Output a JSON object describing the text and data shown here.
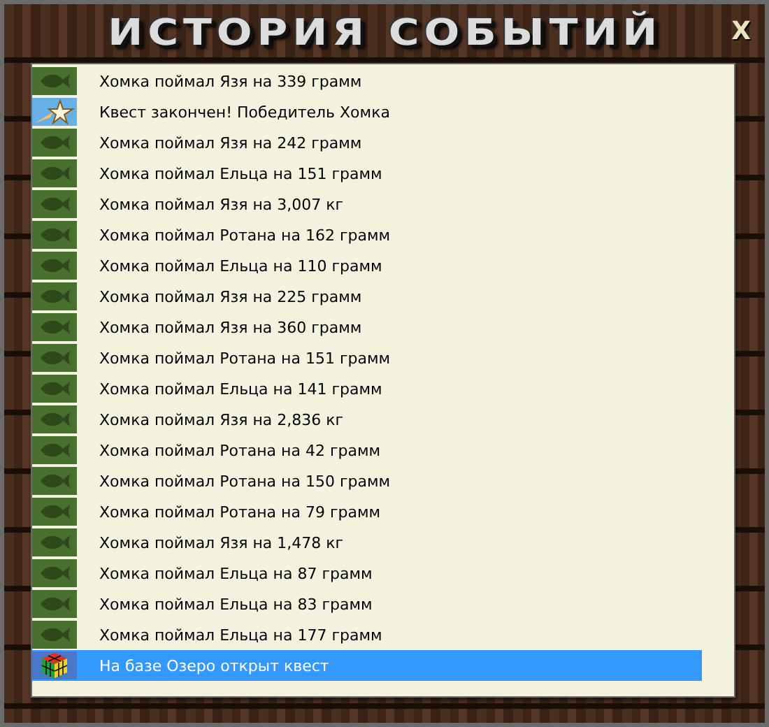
{
  "window": {
    "title": "ИСТОРИЯ СОБЫТИЙ",
    "close": "X"
  },
  "events": [
    {
      "kind": "fish",
      "text": "Хомка поймал Язя на 339 грамм",
      "selected": false
    },
    {
      "kind": "star",
      "text": "Квест закончен! Победитель Хомка",
      "selected": false
    },
    {
      "kind": "fish",
      "text": "Хомка поймал Язя на 242 грамм",
      "selected": false
    },
    {
      "kind": "fish",
      "text": "Хомка поймал Ельца на 151 грамм",
      "selected": false
    },
    {
      "kind": "fish",
      "text": "Хомка поймал Язя на 3,007 кг",
      "selected": false
    },
    {
      "kind": "fish",
      "text": "Хомка поймал Ротана на 162 грамм",
      "selected": false
    },
    {
      "kind": "fish",
      "text": "Хомка поймал Ельца на 110 грамм",
      "selected": false
    },
    {
      "kind": "fish",
      "text": "Хомка поймал Язя на 225 грамм",
      "selected": false
    },
    {
      "kind": "fish",
      "text": "Хомка поймал Язя на 360 грамм",
      "selected": false
    },
    {
      "kind": "fish",
      "text": "Хомка поймал Ротана на 151 грамм",
      "selected": false
    },
    {
      "kind": "fish",
      "text": "Хомка поймал Ельца на 141 грамм",
      "selected": false
    },
    {
      "kind": "fish",
      "text": "Хомка поймал Язя на 2,836 кг",
      "selected": false
    },
    {
      "kind": "fish",
      "text": "Хомка поймал Ротана на 42 грамм",
      "selected": false
    },
    {
      "kind": "fish",
      "text": "Хомка поймал Ротана на 150 грамм",
      "selected": false
    },
    {
      "kind": "fish",
      "text": "Хомка поймал Ротана на 79 грамм",
      "selected": false
    },
    {
      "kind": "fish",
      "text": "Хомка поймал Язя на 1,478 кг",
      "selected": false
    },
    {
      "kind": "fish",
      "text": "Хомка поймал Ельца на 87 грамм",
      "selected": false
    },
    {
      "kind": "fish",
      "text": "Хомка поймал Ельца на 83 грамм",
      "selected": false
    },
    {
      "kind": "fish",
      "text": "Хомка поймал Ельца на 177 грамм",
      "selected": false
    },
    {
      "kind": "cube",
      "text": "На базе Озеро открыт квест",
      "selected": true
    }
  ]
}
